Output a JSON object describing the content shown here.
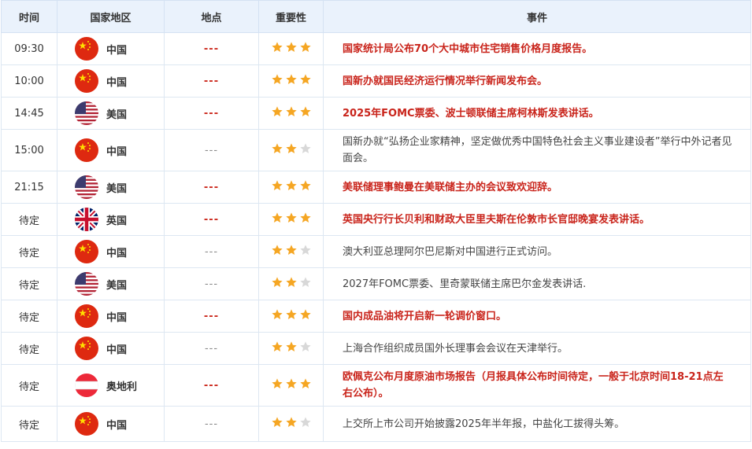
{
  "header": {
    "time": "时间",
    "country": "国家地区",
    "place": "地点",
    "importance": "重要性",
    "event": "事件"
  },
  "colors": {
    "star_on": "#f5a623",
    "star_off": "#d8d8d8",
    "highlight": "#c9241b",
    "header_bg": "#eaf2fc"
  },
  "rows": [
    {
      "time": "09:30",
      "flag": "china-flag-icon",
      "country": "中国",
      "place": "---",
      "stars": 3,
      "highlight": true,
      "event": "国家统计局公布70个大中城市住宅销售价格月度报告。"
    },
    {
      "time": "10:00",
      "flag": "china-flag-icon",
      "country": "中国",
      "place": "---",
      "stars": 3,
      "highlight": true,
      "event": "国新办就国民经济运行情况举行新闻发布会。"
    },
    {
      "time": "14:45",
      "flag": "usa-flag-icon",
      "country": "美国",
      "place": "---",
      "stars": 3,
      "highlight": true,
      "event": "2025年FOMC票委、波士顿联储主席柯林斯发表讲话。"
    },
    {
      "time": "15:00",
      "flag": "china-flag-icon",
      "country": "中国",
      "place": "---",
      "stars": 2,
      "highlight": false,
      "event": "国新办就“弘扬企业家精神，坚定做优秀中国特色社会主义事业建设者”举行中外记者见面会。"
    },
    {
      "time": "21:15",
      "flag": "usa-flag-icon",
      "country": "美国",
      "place": "---",
      "stars": 3,
      "highlight": true,
      "event": "美联储理事鲍曼在美联储主办的会议致欢迎辞。"
    },
    {
      "time": "待定",
      "flag": "uk-flag-icon",
      "country": "英国",
      "place": "---",
      "stars": 3,
      "highlight": true,
      "event": "英国央行行长贝利和财政大臣里夫斯在伦敦市长官邸晚宴发表讲话。"
    },
    {
      "time": "待定",
      "flag": "china-flag-icon",
      "country": "中国",
      "place": "---",
      "stars": 2,
      "highlight": false,
      "event": "澳大利亚总理阿尔巴尼斯对中国进行正式访问。"
    },
    {
      "time": "待定",
      "flag": "usa-flag-icon",
      "country": "美国",
      "place": "---",
      "stars": 2,
      "highlight": false,
      "event": "2027年FOMC票委、里奇蒙联储主席巴尔金发表讲话."
    },
    {
      "time": "待定",
      "flag": "china-flag-icon",
      "country": "中国",
      "place": "---",
      "stars": 3,
      "highlight": true,
      "event": "国内成品油将开启新一轮调价窗口。"
    },
    {
      "time": "待定",
      "flag": "china-flag-icon",
      "country": "中国",
      "place": "---",
      "stars": 2,
      "highlight": false,
      "event": "上海合作组织成员国外长理事会会议在天津举行。"
    },
    {
      "time": "待定",
      "flag": "austria-flag-icon",
      "country": "奥地利",
      "place": "---",
      "stars": 3,
      "highlight": true,
      "event": "欧佩克公布月度原油市场报告（月报具体公布时间待定，一般于北京时间18-21点左右公布）。"
    },
    {
      "time": "待定",
      "flag": "china-flag-icon",
      "country": "中国",
      "place": "---",
      "stars": 2,
      "highlight": false,
      "event": "上交所上市公司开始披露2025年半年报，中盐化工拔得头筹。"
    }
  ]
}
